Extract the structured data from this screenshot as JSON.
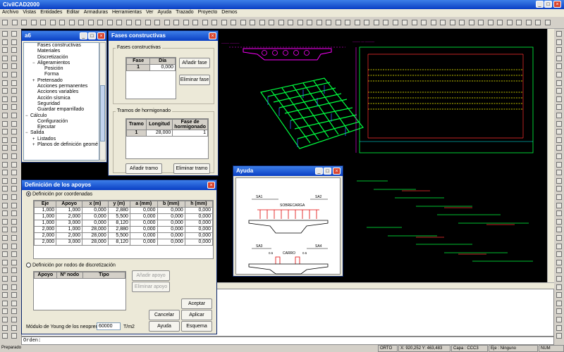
{
  "app": {
    "title": "CivilCAD2000"
  },
  "menu": [
    "Archivo",
    "Vistas",
    "Entidades",
    "Editar",
    "Armaduras",
    "Herramientas",
    "Ver",
    "Ayuda",
    "Trazado",
    "Proyecto",
    "Demos"
  ],
  "tree_window": {
    "title": "a6",
    "items": [
      {
        "label": "Fases constructivas",
        "level": 2,
        "expander": ""
      },
      {
        "label": "Materiales",
        "level": 2,
        "expander": ""
      },
      {
        "label": "Discretización",
        "level": 2,
        "expander": ""
      },
      {
        "label": "Aligeramientos",
        "level": 2,
        "expander": "−"
      },
      {
        "label": "Posición",
        "level": 3,
        "expander": ""
      },
      {
        "label": "Forma",
        "level": 3,
        "expander": ""
      },
      {
        "label": "Pretensado",
        "level": 2,
        "expander": "+"
      },
      {
        "label": "Acciones permanentes",
        "level": 2,
        "expander": ""
      },
      {
        "label": "Acciones variables",
        "level": 2,
        "expander": ""
      },
      {
        "label": "Acción sísmica",
        "level": 2,
        "expander": ""
      },
      {
        "label": "Seguridad",
        "level": 2,
        "expander": ""
      },
      {
        "label": "Guardar emparrillado",
        "level": 2,
        "expander": ""
      },
      {
        "label": "Cálculo",
        "level": 1,
        "expander": "−"
      },
      {
        "label": "Configuración",
        "level": 2,
        "expander": ""
      },
      {
        "label": "Ejecutar",
        "level": 2,
        "expander": ""
      },
      {
        "label": "Salida",
        "level": 1,
        "expander": "−"
      },
      {
        "label": "Listados",
        "level": 2,
        "expander": "+"
      },
      {
        "label": "Planos de definición geomé",
        "level": 2,
        "expander": "+"
      }
    ]
  },
  "fases_window": {
    "title": "Fases constructivas",
    "group1_label": "Fases constructivas",
    "fase_headers": [
      "Fase",
      "Día"
    ],
    "fase_rows": [
      [
        "1",
        "0,000"
      ]
    ],
    "add_fase": "Añadir fase",
    "del_fase": "Eliminar fase",
    "group2_label": "Tramos de hormigonado",
    "tramo_headers": [
      "Tramo",
      "Longitud",
      "Fase de hormigonado"
    ],
    "tramo_rows": [
      [
        "1",
        "28,000",
        "1"
      ]
    ],
    "add_tramo": "Añadir tramo",
    "del_tramo": "Eliminar tramo"
  },
  "apoyos_window": {
    "title": "Definición de los apoyos",
    "radio1": "Definición por coordenadas",
    "headers": [
      "Eje",
      "Apoyo",
      "x (m)",
      "y (m)",
      "a (mm)",
      "b (mm)",
      "h (mm)"
    ],
    "rows": [
      [
        "1,000",
        "1,000",
        "0,000",
        "2,880",
        "0,000",
        "0,000",
        "0,000"
      ],
      [
        "1,000",
        "2,000",
        "0,000",
        "5,500",
        "0,000",
        "0,000",
        "0,000"
      ],
      [
        "1,000",
        "3,000",
        "0,000",
        "8,120",
        "0,000",
        "0,000",
        "0,000"
      ],
      [
        "2,000",
        "1,000",
        "28,000",
        "2,880",
        "0,000",
        "0,000",
        "0,000"
      ],
      [
        "2,000",
        "2,000",
        "28,000",
        "5,500",
        "0,000",
        "0,000",
        "0,000"
      ],
      [
        "2,000",
        "3,000",
        "28,000",
        "8,120",
        "0,000",
        "0,000",
        "0,000"
      ]
    ],
    "radio2": "Definición por nodos de discretización",
    "node_headers": [
      "Apoyo",
      "Nº nodo",
      "Tipo"
    ],
    "add_apoyo": "Añadir apoyo",
    "del_apoyo": "Eliminar apoyo",
    "young_label": "Módulo de Young de los neoprenos :",
    "young_value": "60000",
    "young_unit": "T/m2",
    "btn_accept": "Aceptar",
    "btn_cancel": "Cancelar",
    "btn_apply": "Aplicar",
    "btn_help": "Ayuda",
    "btn_scheme": "Esquema"
  },
  "ayuda_window": {
    "title": "Ayuda",
    "sa1": "SA1",
    "sa2": "SA2",
    "sa3": "SA3",
    "sa4": "SA4",
    "sobrecarga": "SOBRECARGA",
    "carro": "CARRO",
    "d1": "0.5",
    "d2": "0.5"
  },
  "command": {
    "label": "Orden:"
  },
  "status": {
    "left": "Preparado",
    "orto": "ORTO",
    "x_label": "X:",
    "x_value": "920,252",
    "y_label": "Y:",
    "y_value": "463,483",
    "capa": "Capa : CCC3",
    "eje": "Eje : Ninguno",
    "num": "NUM"
  },
  "colors": {
    "canvas": "#000000",
    "accent": "#0a3fc4"
  }
}
